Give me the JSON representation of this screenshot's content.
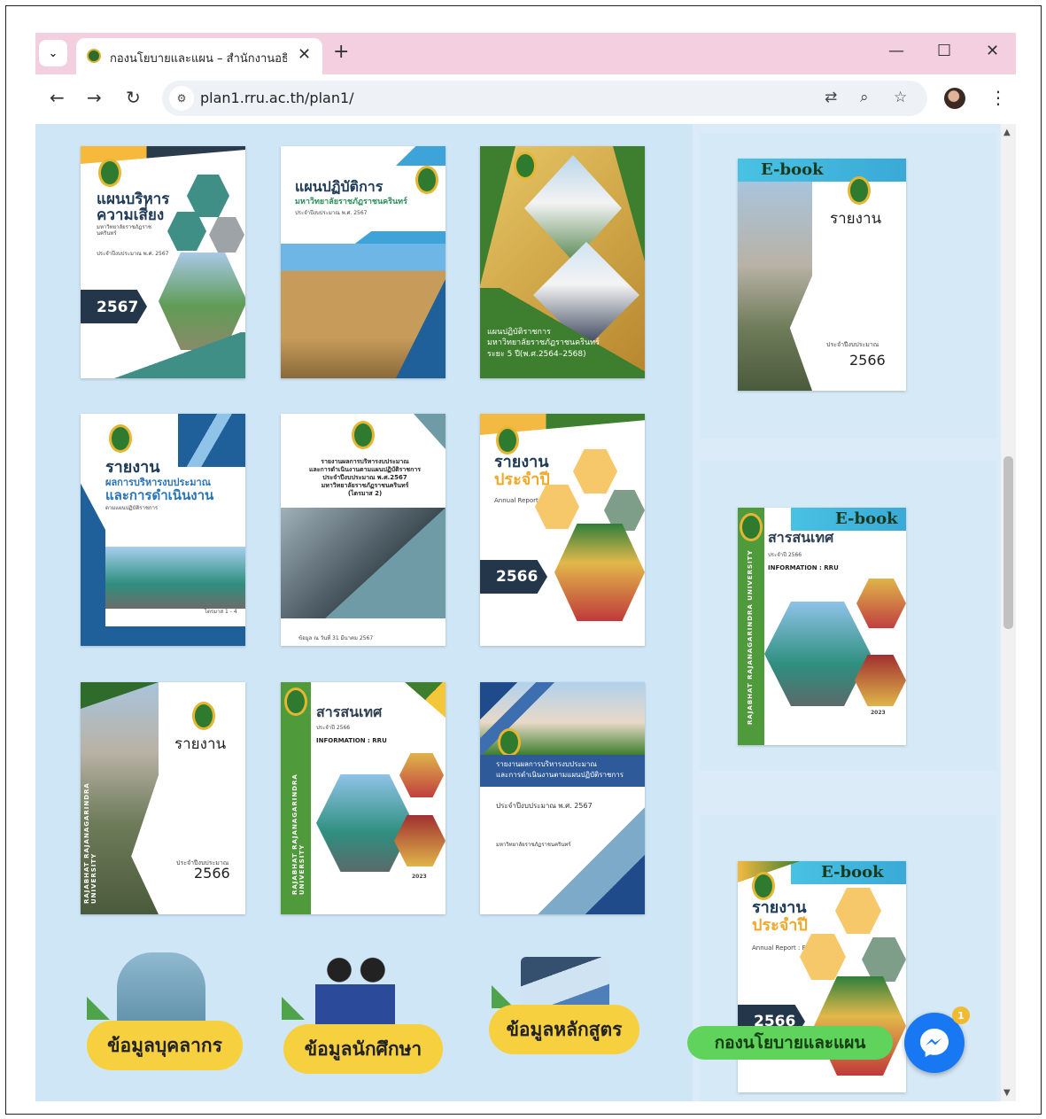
{
  "browser": {
    "tab_title": "กองนโยบายและแผน – สำนักงานอธิก",
    "url": "plan1.rru.ac.th/plan1/",
    "new_tab": "+",
    "close_tab": "✕",
    "minimize": "—",
    "maximize": "☐",
    "close_window": "✕"
  },
  "books": [
    {
      "title1": "แผนบริหาร",
      "title2": "ความเสี่ยง",
      "sub": "มหาวิทยาลัยราชภัฏราชนครินทร์",
      "note": "ประจำปีงบประมาณ พ.ศ. 2567",
      "year": "2567"
    },
    {
      "title1": "แผนปฏิบัติการ",
      "title2": "มหาวิทยาลัยราชภัฏราชนครินทร์",
      "sub": "ประจำปีงบประมาณ พ.ศ. 2567"
    },
    {
      "title1": "แผนปฏิบัติราชการ",
      "title2": "มหาวิทยาลัยราชภัฏราชนครินทร์",
      "sub": "ระยะ 5 ปี(พ.ศ.2564–2568)"
    },
    {
      "title1": "รายงาน",
      "title2": "ผลการบริหารงบประมาณ",
      "title3": "และการดำเนินงาน",
      "sub": "ตามแผนปฏิบัติราชการ",
      "note": "ไตรมาส 1 - 4"
    },
    {
      "title1": "รายงานผลการบริหารงบประมาณ",
      "title2": "และการดำเนินงานตามแผนปฏิบัติราชการ",
      "title3": "ประจำปีงบประมาณ พ.ศ.2567",
      "title4": "มหาวิทยาลัยราชภัฏราชนครินทร์",
      "title5": "(ไตรมาส 2)",
      "note": "ข้อมูล ณ วันที่ 31 มีนาคม 2567"
    },
    {
      "title1": "รายงาน",
      "title2": "ประจำปี",
      "sub": "Annual Report : RRU",
      "year": "2566"
    },
    {
      "title1": "รายงาน",
      "sub": "ประจำปีงบประมาณ",
      "year": "2566",
      "vertical": "RAJABHAT RAJANAGARINDRA UNIVERSITY"
    },
    {
      "title1": "สารสนเทศ",
      "sub": "ประจำปี 2566",
      "info": "INFORMATION : RRU",
      "year": "2023",
      "vertical": "RAJABHAT RAJANAGARINDRA UNIVERSITY"
    },
    {
      "title1": "รายงานผลการบริหารงบประมาณ",
      "title2": "และการดำเนินงานตามแผนปฏิบัติราชการ",
      "sub": "ประจำปีงบประมาณ พ.ศ. 2567",
      "note": "มหาวิทยาลัยราชภัฏราชนครินทร์"
    }
  ],
  "tiles": [
    {
      "label": "ข้อมูลบุคลากร"
    },
    {
      "label": "ข้อมูลนักศึกษา"
    },
    {
      "label": "ข้อมูลหลักสูตร"
    }
  ],
  "sidebar": [
    {
      "badge": "E-book",
      "title": "รายงาน",
      "sub": "ประจำปีงบประมาณ",
      "year": "2566"
    },
    {
      "badge": "E-book",
      "title": "สารสนเทศ",
      "sub": "ประจำปี 2566",
      "info": "INFORMATION : RRU",
      "year": "2023",
      "vertical": "RAJABHAT RAJANAGARINDRA UNIVERSITY"
    },
    {
      "badge": "E-book",
      "title1": "รายงาน",
      "title2": "ประจำปี",
      "sub": "Annual Report : RRU",
      "year": "2566"
    }
  ],
  "chat": {
    "label": "กองนโยบายและแผน",
    "count": "1"
  }
}
